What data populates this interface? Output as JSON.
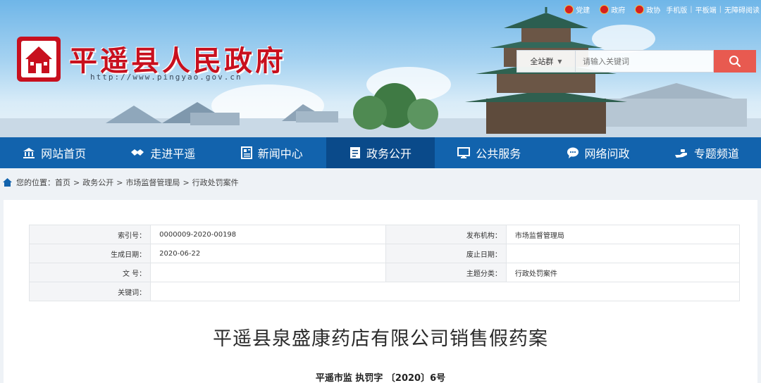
{
  "header": {
    "site_title": "平遥县人民政府",
    "site_url": "http://www.pingyao.gov.cn",
    "top_links": [
      {
        "label": "党建",
        "icon": "party-emblem-icon"
      },
      {
        "label": "政府",
        "icon": "national-emblem-icon"
      },
      {
        "label": "政协",
        "icon": "cppcc-emblem-icon"
      }
    ],
    "top_plain_links": [
      "手机版",
      "平板端",
      "无障碍阅读"
    ],
    "search": {
      "scope": "全站群",
      "placeholder": "请输入关键词",
      "button_icon": "search-icon"
    }
  },
  "nav": {
    "items": [
      {
        "label": "网站首页",
        "icon": "home-bank-icon"
      },
      {
        "label": "走进平遥",
        "icon": "handshake-icon"
      },
      {
        "label": "新闻中心",
        "icon": "newspaper-icon"
      },
      {
        "label": "政务公开",
        "icon": "document-icon"
      },
      {
        "label": "公共服务",
        "icon": "monitor-icon"
      },
      {
        "label": "网络问政",
        "icon": "chat-icon"
      },
      {
        "label": "专题频道",
        "icon": "hand-icon"
      }
    ],
    "active_index": 3
  },
  "breadcrumb": {
    "prefix": "您的位置：",
    "items": [
      "首页",
      "政务公开",
      "市场监督管理局",
      "行政处罚案件"
    ]
  },
  "meta": {
    "index_label": "索引号：",
    "index_value": "0000009-2020-00198",
    "publisher_label": "发布机构：",
    "publisher_value": "市场监督管理局",
    "created_label": "生成日期：",
    "created_value": "2020-06-22",
    "expiry_label": "废止日期：",
    "expiry_value": "",
    "docno_label": "文  号：",
    "docno_value": "",
    "topic_label": "主题分类：",
    "topic_value": "行政处罚案件",
    "keywords_label": "关键词：",
    "keywords_value": ""
  },
  "article": {
    "title": "平遥县泉盛康药店有限公司销售假药案",
    "doc_number": "平遥市监 执罚字 〔2020〕6号"
  },
  "colors": {
    "nav_bg": "#1263ad",
    "nav_active": "#0a4a8a",
    "title_red": "#c8101e",
    "search_button": "#e85a50"
  }
}
